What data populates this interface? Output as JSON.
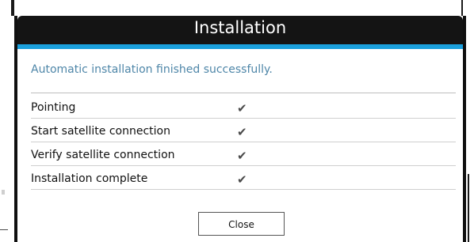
{
  "dialog": {
    "title": "Installation",
    "message": "Automatic installation finished successfully.",
    "steps": [
      {
        "label": "Pointing",
        "status_icon": "checkmark-icon"
      },
      {
        "label": "Start satellite connection",
        "status_icon": "checkmark-icon"
      },
      {
        "label": "Verify satellite connection",
        "status_icon": "checkmark-icon"
      },
      {
        "label": "Installation complete",
        "status_icon": "checkmark-icon"
      }
    ],
    "close_label": "Close"
  },
  "colors": {
    "titlebar": "#141414",
    "accent": "#1aa0dd",
    "message_text": "#4e86a8",
    "check": "#4a4a4a"
  }
}
